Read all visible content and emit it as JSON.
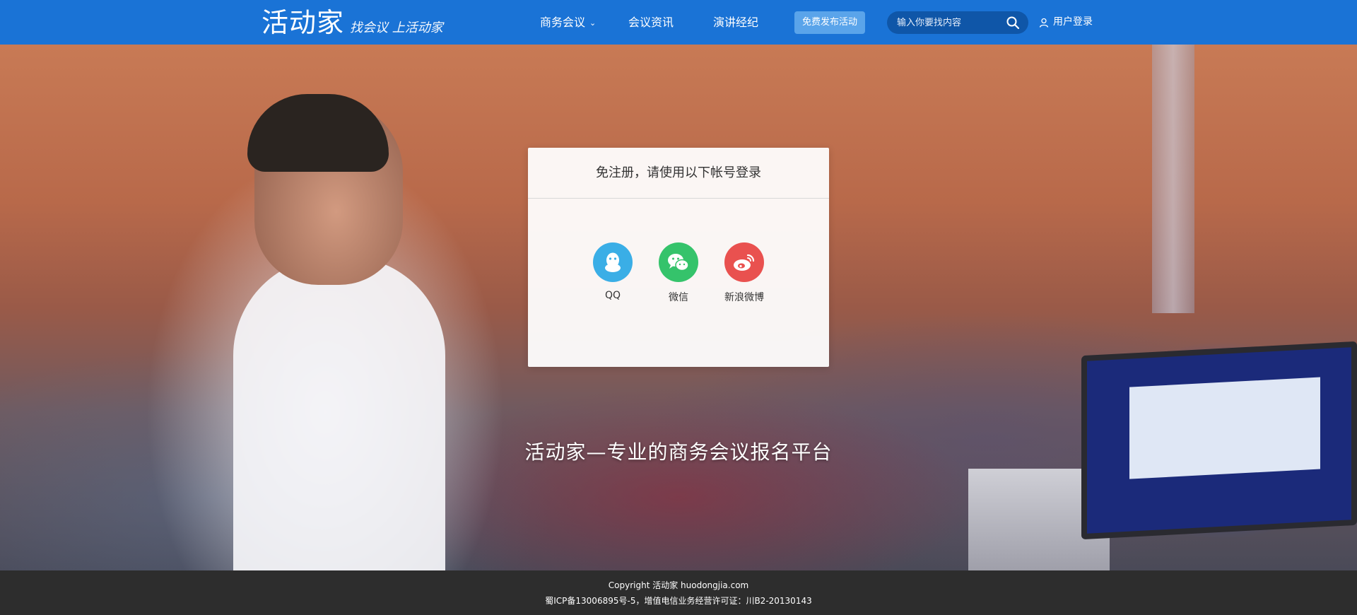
{
  "header": {
    "logo_text": "活动家",
    "logo_slogan": "找会议 上活动家",
    "nav": [
      {
        "label": "商务会议",
        "has_dropdown": true
      },
      {
        "label": "会议资讯",
        "has_dropdown": false
      },
      {
        "label": "演讲经纪",
        "has_dropdown": false
      }
    ],
    "publish_label": "免费发布活动",
    "search": {
      "placeholder": "输入你要找内容",
      "icon": "search-icon"
    },
    "login_label": "用户登录",
    "login_icon": "user-icon"
  },
  "login_card": {
    "title": "免注册，请使用以下帐号登录",
    "providers": [
      {
        "label": "QQ",
        "icon": "qq-icon",
        "color": "#3aaee6"
      },
      {
        "label": "微信",
        "icon": "wechat-icon",
        "color": "#35c36b"
      },
      {
        "label": "新浪微博",
        "icon": "weibo-icon",
        "color": "#e9514f"
      }
    ]
  },
  "hero": {
    "tagline": "活动家—专业的商务会议报名平台"
  },
  "footer": {
    "copyright": "Copyright 活动家 huodongjia.com",
    "icp": "蜀ICP备13006895号-5，增值电信业务经营许可证：川B2-20130143"
  },
  "colors": {
    "header_bg": "#1a73d6",
    "publish_btn_bg": "#5aa4ea",
    "search_bg": "#0f56a8",
    "footer_bg": "#2d2d2d"
  }
}
